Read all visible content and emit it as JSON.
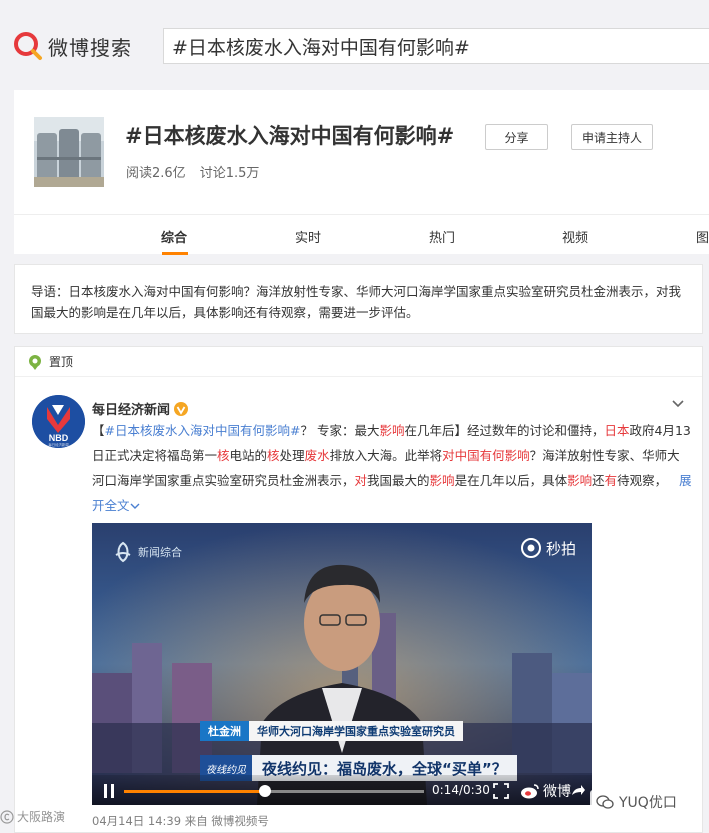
{
  "header": {
    "logo_text": "微博搜索",
    "search_value": "#日本核废水入海对中国有何影响#"
  },
  "topic": {
    "title": "#日本核废水入海对中国有何影响#",
    "share_label": "分享",
    "host_label": "申请主持人",
    "reads": "阅读2.6亿",
    "discussions": "讨论1.5万"
  },
  "tabs": [
    {
      "label": "综合"
    },
    {
      "label": "实时"
    },
    {
      "label": "热门"
    },
    {
      "label": "视频"
    },
    {
      "label": "图"
    }
  ],
  "intro": {
    "text": "导语：日本核废水入海对中国有何影响？海洋放射性专家、华师大河口海岸学国家重点实验室研究员杜金洲表示，对我国最大的影响是在几年以后，具体影响还有待观察，需要进一步评估。"
  },
  "feed": {
    "pin_label": "置顶",
    "avatar_text": "NBD",
    "avatar_subtext": "每日经济新闻",
    "author": "每日经济新闻",
    "post": {
      "s1": "【",
      "s2": "#日本核废水入海对中国有何影响#",
      "s3": "？ 专家：最大",
      "s4": "影响",
      "s5": "在几年后】经过数年的讨论和僵持，",
      "s6": "日本",
      "s7": "政府4月13日正式决定将福岛第一",
      "s8": "核",
      "s9": "电站的",
      "s10": "核",
      "s11": "处理",
      "s12": "废水",
      "s13": "排放入大海。此举将",
      "s14": "对中国有何影响",
      "s15": "？海洋放射性专家、华师大河口海岸学国家重点实验室研究员杜金洲表示，",
      "s16": "对",
      "s17": "我国最大的",
      "s18": "影响",
      "s19": "是在几年以后，具体",
      "s20": "影响",
      "s21": "还",
      "s22": "有",
      "s23": "待观察，",
      "expand": "展开全文"
    },
    "video": {
      "channel_logo": "新闻综合",
      "miaopai": "秒拍",
      "name_caption": "杜金洲",
      "title_caption": "华师大河口海岸学国家重点实验室研究员",
      "ticker_program": "夜线约见",
      "ticker_headline": "夜线约见：福岛废水，全球“买单”？",
      "timecode": "0:14/0:30",
      "progress": 0.47,
      "weibo_mark": "微博"
    },
    "meta": "04月14日 14:39  来自 微博视频号"
  },
  "watermarks": {
    "left": "大阪路演",
    "right": "YUQ优口"
  },
  "colors": {
    "accent": "#ff8200",
    "highlight": "#e6393c",
    "link": "#4a7fd1"
  }
}
